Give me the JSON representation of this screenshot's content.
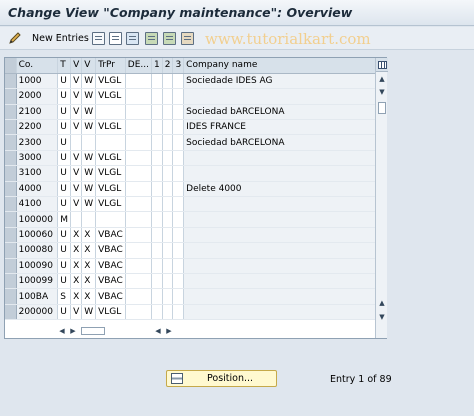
{
  "window": {
    "title": "Change View \"Company maintenance\": Overview"
  },
  "toolbar": {
    "new_entries_label": "New Entries",
    "watermark": "www.tutorialkart.com",
    "icons": [
      "copy-icon",
      "delete-icon",
      "undo-icon",
      "select-all-icon",
      "select-block-icon",
      "deselect-all-icon"
    ]
  },
  "table": {
    "headers": [
      "Co.",
      "T",
      "V",
      "V",
      "TrPr",
      "DE...",
      "1",
      "2",
      "3",
      "Company name"
    ],
    "rows": [
      [
        "1000",
        "U",
        "V",
        "W",
        "VLGL",
        "",
        "",
        "",
        "",
        "Sociedade IDES AG"
      ],
      [
        "2000",
        "U",
        "V",
        "W",
        "VLGL",
        "",
        "",
        "",
        "",
        ""
      ],
      [
        "2100",
        "U",
        "V",
        "W",
        "",
        "",
        "",
        "",
        "",
        "Sociedad bARCELONA"
      ],
      [
        "2200",
        "U",
        "V",
        "W",
        "VLGL",
        "",
        "",
        "",
        "",
        "IDES FRANCE"
      ],
      [
        "2300",
        "U",
        "",
        "",
        "",
        "",
        "",
        "",
        "",
        "Sociedad bARCELONA"
      ],
      [
        "3000",
        "U",
        "V",
        "W",
        "VLGL",
        "",
        "",
        "",
        "",
        ""
      ],
      [
        "3100",
        "U",
        "V",
        "W",
        "VLGL",
        "",
        "",
        "",
        "",
        ""
      ],
      [
        "4000",
        "U",
        "V",
        "W",
        "VLGL",
        "",
        "",
        "",
        "",
        "Delete 4000"
      ],
      [
        "4100",
        "U",
        "V",
        "W",
        "VLGL",
        "",
        "",
        "",
        "",
        ""
      ],
      [
        "100000",
        "M",
        "",
        "",
        "",
        "",
        "",
        "",
        "",
        ""
      ],
      [
        "100060",
        "U",
        "X",
        "X",
        "VBAC",
        "",
        "",
        "",
        "",
        ""
      ],
      [
        "100080",
        "U",
        "X",
        "X",
        "VBAC",
        "",
        "",
        "",
        "",
        ""
      ],
      [
        "100090",
        "U",
        "X",
        "X",
        "VBAC",
        "",
        "",
        "",
        "",
        ""
      ],
      [
        "100099",
        "U",
        "X",
        "X",
        "VBAC",
        "",
        "",
        "",
        "",
        ""
      ],
      [
        "100BA",
        "S",
        "X",
        "X",
        "VBAC",
        "",
        "",
        "",
        "",
        ""
      ],
      [
        "200000",
        "U",
        "V",
        "W",
        "VLGL",
        "",
        "",
        "",
        "",
        ""
      ]
    ]
  },
  "footer": {
    "position_button_label": "Position...",
    "entry_info": "Entry 1 of 89"
  }
}
